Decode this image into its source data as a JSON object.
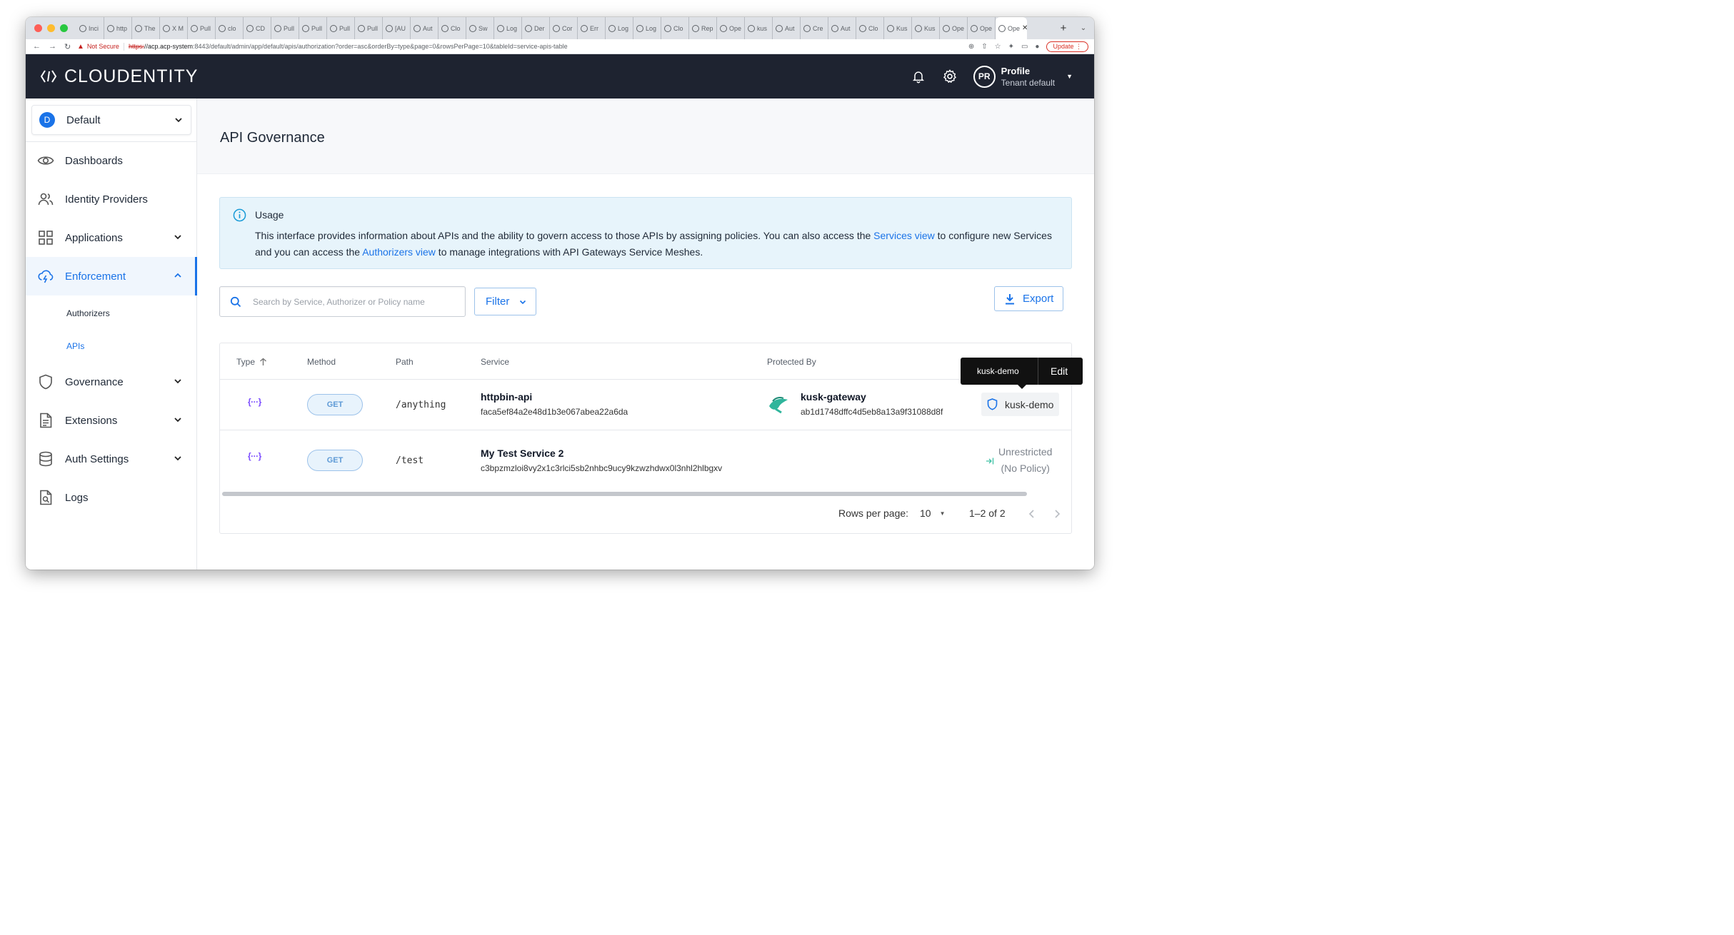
{
  "browser": {
    "tabs": [
      "Inci",
      "http",
      "The",
      "X M",
      "Pull",
      "clo",
      "CD",
      "Pull",
      "Pull",
      "Pull",
      "Pull",
      "[AU",
      "Aut",
      "Clo",
      "Sw",
      "Log",
      "Der",
      "Cor",
      "Err",
      "Log",
      "Log",
      "Clo",
      "Rep",
      "Ope",
      "kus",
      "Aut",
      "Cre",
      "Aut",
      "Clo",
      "Kus",
      "Kus",
      "Ope",
      "Ope",
      "Ope"
    ],
    "security_label": "Not Secure",
    "url_scheme": "https:",
    "url_host": "//acp.acp-system",
    "url_rest": ":8443/default/admin/app/default/apis/authorization?order=asc&orderBy=type&page=0&rowsPerPage=10&tableId=service-apis-table",
    "update_label": "Update"
  },
  "header": {
    "logo_text": "CLOUDENTITY",
    "avatar_initials": "PR",
    "profile_label": "Profile",
    "tenant_label": "Tenant default"
  },
  "sidebar": {
    "tenant_initial": "D",
    "tenant_name": "Default",
    "items": {
      "dashboards": "Dashboards",
      "identity_providers": "Identity Providers",
      "applications": "Applications",
      "enforcement": "Enforcement",
      "authorizers": "Authorizers",
      "apis": "APIs",
      "governance": "Governance",
      "extensions": "Extensions",
      "auth_settings": "Auth Settings",
      "logs": "Logs"
    }
  },
  "main": {
    "title": "API Governance",
    "usage": {
      "title": "Usage",
      "text_1": "This interface provides information about APIs and the ability to govern access to those APIs by assigning policies. You can also access the ",
      "link_services": "Services view",
      "text_2": " to configure new Services and you can access the ",
      "link_authorizers": "Authorizers view",
      "text_3": " to manage integrations with API Gateways Service Meshes."
    },
    "search_placeholder": "Search by Service, Authorizer or Policy name",
    "filter_label": "Filter",
    "export_label": "Export",
    "table": {
      "columns": {
        "type": "Type",
        "method": "Method",
        "path": "Path",
        "service": "Service",
        "protected_by": "Protected By"
      },
      "rows": [
        {
          "type_icon": "{···}",
          "method": "GET",
          "path": "/anything",
          "service_name": "httpbin-api",
          "service_id": "faca5ef84a2e48d1b3e067abea22a6da",
          "protected_name": "kusk-gateway",
          "protected_id": "ab1d1748dffc4d5eb8a13a9f31088d8f",
          "policy": "kusk-demo"
        },
        {
          "type_icon": "{···}",
          "method": "GET",
          "path": "/test",
          "service_name": "My Test Service 2",
          "service_id": "c3bpzmzloi8vy2x1c3rlci5sb2nhbc9ucy9kzwzhdwx0l3nhl2hlbgxv",
          "policy_line1": "Unrestricted",
          "policy_line2": "(No Policy)"
        }
      ]
    },
    "tooltip": {
      "name": "kusk-demo",
      "action": "Edit"
    },
    "pager": {
      "rows_label": "Rows per page:",
      "rows_value": "10",
      "range": "1–2 of 2"
    }
  }
}
